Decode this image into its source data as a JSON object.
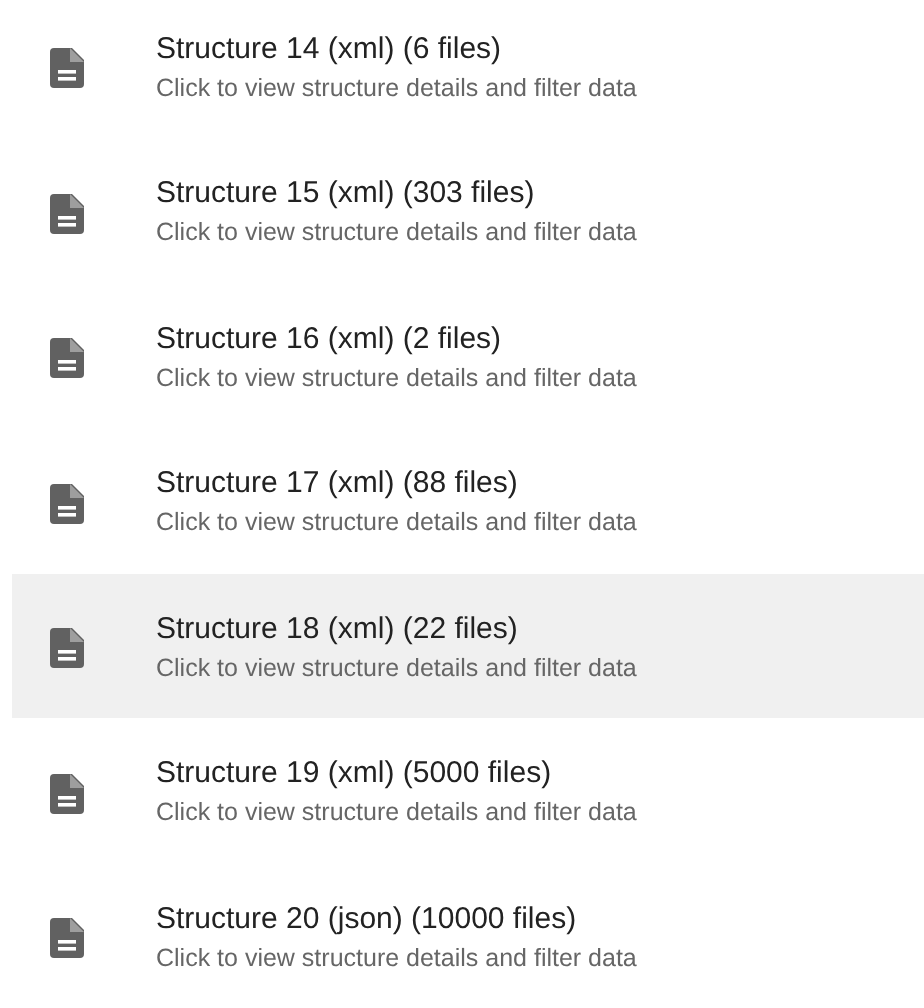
{
  "items": [
    {
      "title": "Structure 14 (xml) (6 files)",
      "subtitle": "Click to view structure details and filter data",
      "selected": false
    },
    {
      "title": "Structure 15 (xml) (303 files)",
      "subtitle": "Click to view structure details and filter data",
      "selected": false
    },
    {
      "title": "Structure 16 (xml) (2 files)",
      "subtitle": "Click to view structure details and filter data",
      "selected": false
    },
    {
      "title": "Structure 17 (xml) (88 files)",
      "subtitle": "Click to view structure details and filter data",
      "selected": false
    },
    {
      "title": "Structure 18 (xml) (22 files)",
      "subtitle": "Click to view structure details and filter data",
      "selected": true
    },
    {
      "title": "Structure 19 (xml) (5000 files)",
      "subtitle": "Click to view structure details and filter data",
      "selected": false
    },
    {
      "title": "Structure 20 (json) (10000 files)",
      "subtitle": "Click to view structure details and filter data",
      "selected": false
    }
  ]
}
